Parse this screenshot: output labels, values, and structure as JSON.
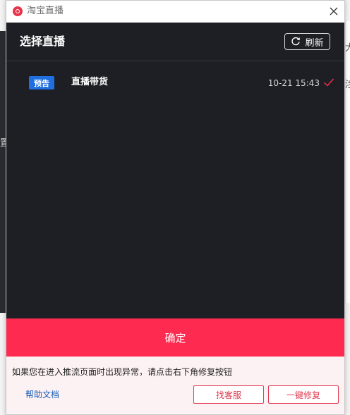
{
  "window": {
    "title": "淘宝直播"
  },
  "background": {
    "left_fragment": "置",
    "right_fragment_1": "大",
    "right_fragment_2": "涉"
  },
  "panel": {
    "title": "选择直播",
    "refresh_label": "刷新"
  },
  "live_list": [
    {
      "badge": "预告",
      "name": "直播带货",
      "time": "10-21 15:43",
      "selected": true
    }
  ],
  "confirm_label": "确定",
  "footer": {
    "message": "如果您在进入推流页面时出现异常，请点击右下角修复按钮",
    "help_link": "帮助文档",
    "service_button": "找客服",
    "fix_button": "一键修复"
  },
  "colors": {
    "accent": "#ff2a4f",
    "panel_bg": "#1e1f24",
    "badge_bg": "#1f6fe0",
    "footer_bg": "#fdf2f3",
    "link": "#1a5fb4"
  }
}
